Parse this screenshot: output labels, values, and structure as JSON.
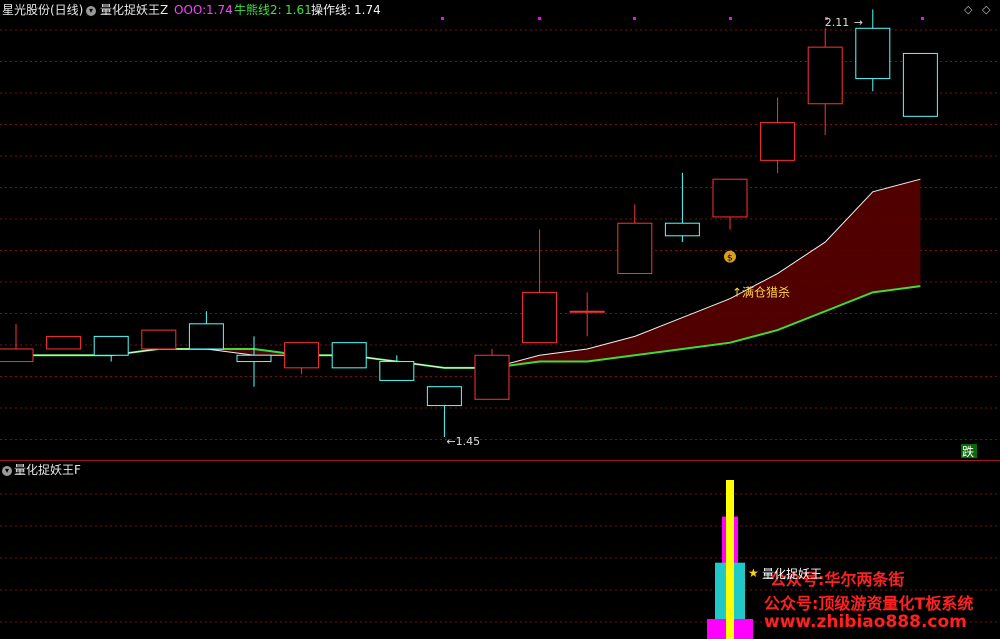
{
  "header": {
    "stock_name": "星光股份(日线)",
    "indicator_name": "量化捉妖王Z",
    "ooo_label": "OOO: ",
    "ooo_value": "1.74",
    "bull_label": "牛熊线2: ",
    "bull_value": "1.61",
    "op_label": "操作线: ",
    "op_value": "1.74",
    "diamond_icon": "diamond-icon",
    "collapse_icon": "circle-chevron-icon"
  },
  "main_chart": {
    "high_label": "2.11",
    "low_label": "1.45",
    "signal_text": "↑满仓猎杀",
    "fall_badge": "跌",
    "money_bag_icon": "money-bag-icon"
  },
  "sub_chart": {
    "title": "量化捉妖王F",
    "legend_label": "量化捉妖王",
    "star_icon": "star-icon"
  },
  "watermarks": {
    "line1": "公众号:华尔两条街",
    "line2": "公众号:顶级游资量化T板系统",
    "line3": "www.zhibiao888.com"
  },
  "colors": {
    "up": "#ff3232",
    "down": "#54ffff",
    "bull_line": "#3cdc3c",
    "op_line": "#f0f0f0",
    "fill": "#5a0000",
    "magenta": "#ff00ff",
    "yellow": "#ffff00"
  },
  "chart_data": {
    "type": "candlestick",
    "candles": [
      {
        "open": 1.57,
        "close": 1.59,
        "high": 1.63,
        "low": 1.57
      },
      {
        "open": 1.59,
        "close": 1.61,
        "high": 1.61,
        "low": 1.59
      },
      {
        "open": 1.61,
        "close": 1.58,
        "high": 1.61,
        "low": 1.57
      },
      {
        "open": 1.59,
        "close": 1.62,
        "high": 1.62,
        "low": 1.59
      },
      {
        "open": 1.63,
        "close": 1.59,
        "high": 1.65,
        "low": 1.59
      },
      {
        "open": 1.58,
        "close": 1.57,
        "high": 1.61,
        "low": 1.53
      },
      {
        "open": 1.56,
        "close": 1.6,
        "high": 1.6,
        "low": 1.55
      },
      {
        "open": 1.6,
        "close": 1.56,
        "high": 1.6,
        "low": 1.56
      },
      {
        "open": 1.57,
        "close": 1.54,
        "high": 1.58,
        "low": 1.54
      },
      {
        "open": 1.53,
        "close": 1.5,
        "high": 1.53,
        "low": 1.45
      },
      {
        "open": 1.51,
        "close": 1.58,
        "high": 1.59,
        "low": 1.51
      },
      {
        "open": 1.6,
        "close": 1.68,
        "high": 1.78,
        "low": 1.6
      },
      {
        "open": 1.65,
        "close": 1.65,
        "high": 1.68,
        "low": 1.61
      },
      {
        "open": 1.71,
        "close": 1.79,
        "high": 1.82,
        "low": 1.71
      },
      {
        "open": 1.79,
        "close": 1.77,
        "high": 1.87,
        "low": 1.76
      },
      {
        "open": 1.8,
        "close": 1.86,
        "high": 1.86,
        "low": 1.78
      },
      {
        "open": 1.89,
        "close": 1.95,
        "high": 1.99,
        "low": 1.87
      },
      {
        "open": 1.98,
        "close": 2.07,
        "high": 2.1,
        "low": 1.93
      },
      {
        "open": 2.1,
        "close": 2.02,
        "high": 2.13,
        "low": 2.0
      },
      {
        "open": 2.06,
        "close": 1.96,
        "high": 2.06,
        "low": 1.96
      }
    ],
    "bull_line": [
      1.58,
      1.58,
      1.58,
      1.59,
      1.59,
      1.59,
      1.58,
      1.58,
      1.57,
      1.56,
      1.56,
      1.57,
      1.57,
      1.58,
      1.59,
      1.6,
      1.62,
      1.65,
      1.68,
      1.69
    ],
    "op_line": [
      1.58,
      1.58,
      1.58,
      1.59,
      1.59,
      1.58,
      1.58,
      1.58,
      1.57,
      1.56,
      1.56,
      1.58,
      1.59,
      1.61,
      1.64,
      1.67,
      1.71,
      1.76,
      1.84,
      1.86
    ],
    "sub_bars": [
      {
        "index": 15,
        "magenta": 0.77,
        "cyan": 0.48,
        "yellow": 1.0
      }
    ],
    "ylim": [
      1.4,
      2.15
    ]
  }
}
